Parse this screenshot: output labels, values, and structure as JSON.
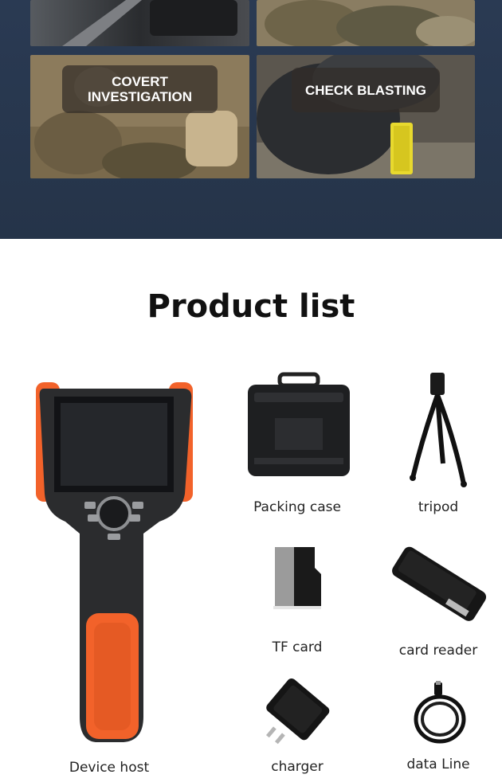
{
  "applications": {
    "tiles": [
      {
        "label": ""
      },
      {
        "label": ""
      },
      {
        "label": "COVERT\nINVESTIGATION"
      },
      {
        "label": "CHECK BLASTING"
      }
    ]
  },
  "product_list": {
    "title": "Product list",
    "items": [
      {
        "label": "Device host"
      },
      {
        "label": "Packing case"
      },
      {
        "label": "tripod"
      },
      {
        "label": "TF card"
      },
      {
        "label": "card reader"
      },
      {
        "label": "charger"
      },
      {
        "label": "data Line"
      }
    ]
  },
  "colors": {
    "section_bg": "#2a3a53",
    "device_accent": "#f2622a"
  }
}
